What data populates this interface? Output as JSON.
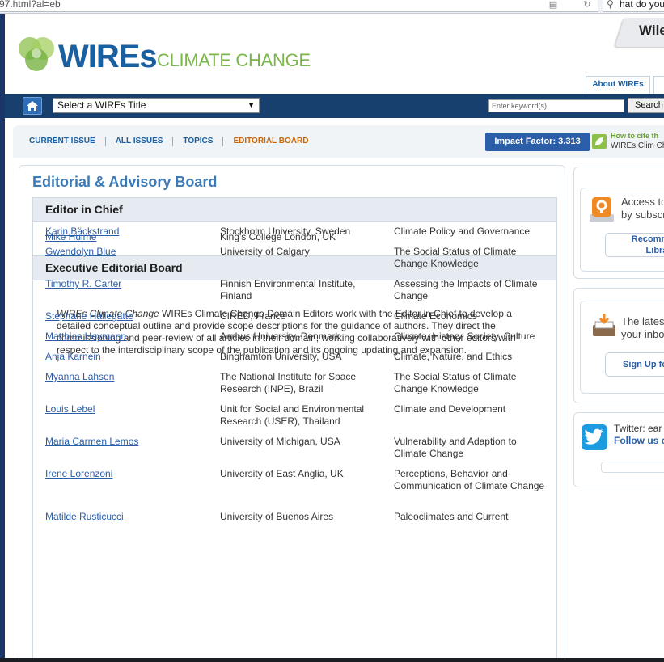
{
  "browser": {
    "url": "97.html?al=eb",
    "search_text": "hat do you"
  },
  "header": {
    "brand": "WIREs",
    "brand_sub": "CLIMATE CHANGE",
    "wiley": "Wile",
    "about_tab": "About WIREs"
  },
  "nav": {
    "select_title": "Select a WIREs Title",
    "keyword_placeholder": "Enter keyword(s)",
    "search_label": "Search"
  },
  "subnav": {
    "links": [
      "CURRENT ISSUE",
      "ALL ISSUES",
      "TOPICS",
      "EDITORIAL BOARD"
    ],
    "impact_factor": "Impact Factor: 3.313",
    "cite_title": "How to cite th",
    "cite_sub": "WIREs Clim Ch"
  },
  "main": {
    "title": "Editorial & Advisory Board",
    "editor_head": "Editor in Chief",
    "editor": {
      "name": "Mike Hulme",
      "affiliation": "King's College London, UK"
    },
    "exec_head": "Executive Editorial Board",
    "intro_em": "WIREs Climate Change",
    "intro_rest": " WIREs Climate Change Domain Editors work with the Editor in Chief to develop a detailed conceptual outline and provide scope descriptions for the guidance of authors. They direct the commissioning and peer-review of all articles in their domain, working collaboratively with other editors with respect to the interdisciplinary scope of the publication and its ongoing updating and expansion.",
    "board": [
      {
        "name": "Karin Bäckstrand",
        "affiliation": "Stockholm University, Sweden",
        "domain": "Climate Policy and Governance"
      },
      {
        "name": "Gwendolyn Blue",
        "affiliation": "University of Calgary",
        "domain": "The Social Status of Climate Change Knowledge"
      },
      {
        "name": "Timothy R. Carter",
        "affiliation": "Finnish Environmental Institute, Finland",
        "domain": "Assessing the Impacts of Climate Change"
      },
      {
        "name": "Stéphane Hallegatte",
        "affiliation": "CIRED, France",
        "domain": "Climate Economics"
      },
      {
        "name": "Matthias Heymann",
        "affiliation": "Aarhus University, Denmark",
        "domain": "Climate, History, Society, Culture"
      },
      {
        "name": "Anja Karnein",
        "affiliation": "Binghamton University, USA",
        "domain": "Climate, Nature, and Ethics"
      },
      {
        "name": "Myanna Lahsen",
        "affiliation": "The National Institute for Space Research (INPE), Brazil",
        "domain": "The Social Status of Climate Change Knowledge"
      },
      {
        "name": "Louis Lebel",
        "affiliation": "Unit for Social and Environmental Research (USER), Thailand",
        "domain": "Climate and Development"
      },
      {
        "name": "Maria Carmen Lemos",
        "affiliation": "University of Michigan, USA",
        "domain": "Vulnerability and Adaption to Climate Change"
      },
      {
        "name": "Irene Lorenzoni",
        "affiliation": "University of East Anglia, UK",
        "domain": "Perceptions, Behavior and Communication of Climate Change"
      },
      {
        "name": "Matilde Rusticucci",
        "affiliation": "University of Buenos Aires",
        "domain": "Paleoclimates and Current"
      }
    ]
  },
  "sidebar": {
    "access_line1": "Access to",
    "access_line2": "by subscr",
    "recommend_line1": "Recomm",
    "recommend_line2": "Libra",
    "latest_line1": "The latest",
    "latest_line2": "your inbo",
    "signup": "Sign Up fo",
    "twitter_title": "Twitter: ear",
    "twitter_link": "Follow us o"
  },
  "colors": {
    "navy": "#17406f",
    "link": "#2b5ea8",
    "green": "#7ab648",
    "orange": "#c8670a"
  }
}
